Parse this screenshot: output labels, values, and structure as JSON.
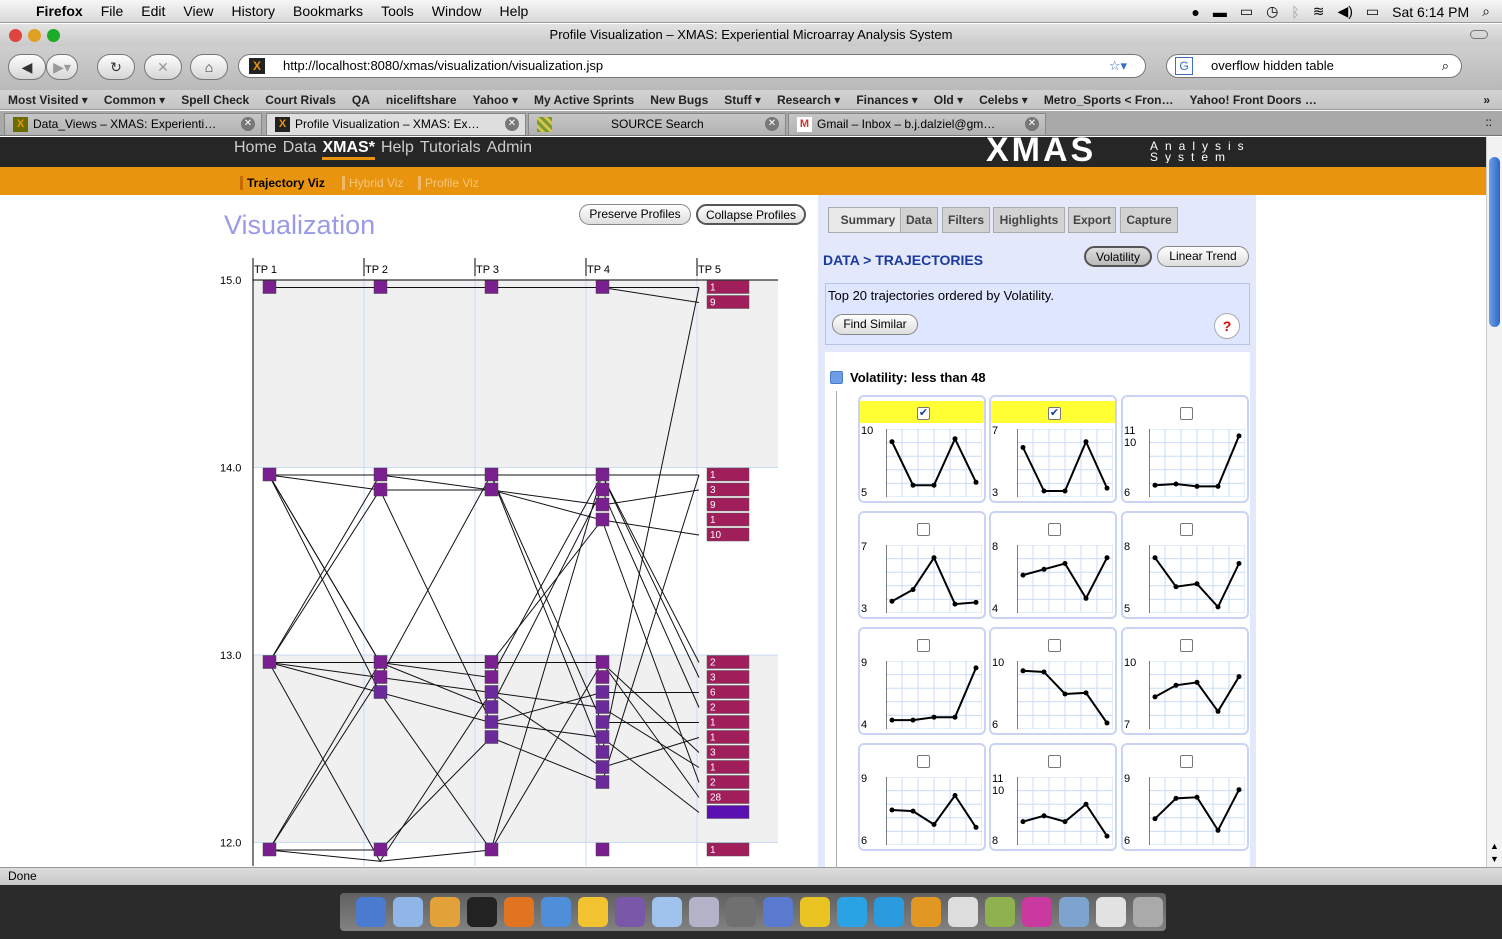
{
  "menubar": {
    "app": "Firefox",
    "items": [
      "File",
      "Edit",
      "View",
      "History",
      "Bookmarks",
      "Tools",
      "Window",
      "Help"
    ],
    "clock": "Sat 6:14 PM"
  },
  "window": {
    "title": "Profile Visualization – XMAS: Experiential Microarray Analysis System"
  },
  "nav": {
    "url": "http://localhost:8080/xmas/visualization/visualization.jsp",
    "search": "overflow hidden table"
  },
  "bookmarks": [
    "Most Visited ▾",
    "Common ▾",
    "Spell Check",
    "Court Rivals",
    "QA",
    "niceliftshare",
    "Yahoo ▾",
    "My Active Sprints",
    "New Bugs",
    "Stuff ▾",
    "Research ▾",
    "Finances ▾",
    "Old ▾",
    "Celebs ▾",
    "Metro_Sports < Fron…",
    "Yahoo! Front Doors …"
  ],
  "tabs": [
    {
      "label": "Data_Views – XMAS: Experienti…"
    },
    {
      "label": "Profile Visualization – XMAS: Ex…"
    },
    {
      "label": "SOURCE Search"
    },
    {
      "label": "Gmail – Inbox – b.j.dalziel@gm…"
    }
  ],
  "app": {
    "nav": [
      "Home",
      "Data",
      "XMAS*",
      "Help",
      "Tutorials",
      "Admin"
    ],
    "logo": "XMAS",
    "logo_sub": "Analysis System",
    "subnav": [
      "Trajectory Viz",
      "Hybrid Viz",
      "Profile Viz"
    ]
  },
  "main": {
    "title": "Visualization",
    "preserve": "Preserve Profiles",
    "collapse": "Collapse Profiles"
  },
  "chart_data": {
    "type": "line",
    "x": [
      "TP 1",
      "TP 2",
      "TP 3",
      "TP 4",
      "TP 5"
    ],
    "yticks": [
      "15.0",
      "14.0",
      "13.0",
      "12.0"
    ],
    "ylim": [
      11.9,
      15.1
    ],
    "labels": [
      {
        "y": 14.96,
        "text": "1"
      },
      {
        "y": 14.88,
        "text": "9"
      },
      {
        "y": 13.96,
        "text": "1"
      },
      {
        "y": 13.88,
        "text": "3"
      },
      {
        "y": 13.8,
        "text": "9"
      },
      {
        "y": 13.72,
        "text": "1"
      },
      {
        "y": 13.64,
        "text": "10"
      },
      {
        "y": 12.96,
        "text": "2"
      },
      {
        "y": 12.88,
        "text": "3"
      },
      {
        "y": 12.8,
        "text": "6"
      },
      {
        "y": 12.72,
        "text": "2"
      },
      {
        "y": 12.64,
        "text": "1"
      },
      {
        "y": 12.56,
        "text": "1"
      },
      {
        "y": 12.48,
        "text": "3"
      },
      {
        "y": 12.4,
        "text": "1"
      },
      {
        "y": 12.32,
        "text": "2"
      },
      {
        "y": 12.24,
        "text": "28"
      },
      {
        "y": 12.16,
        "text": ""
      },
      {
        "y": 11.96,
        "text": "1"
      }
    ],
    "nodes": [
      [
        0,
        14.96
      ],
      [
        1,
        14.96
      ],
      [
        2,
        14.96
      ],
      [
        3,
        14.96
      ],
      [
        0,
        13.96
      ],
      [
        1,
        13.96
      ],
      [
        1,
        13.88
      ],
      [
        2,
        13.96
      ],
      [
        2,
        13.88
      ],
      [
        3,
        13.96
      ],
      [
        3,
        13.88
      ],
      [
        3,
        13.8
      ],
      [
        3,
        13.72
      ],
      [
        0,
        12.96
      ],
      [
        1,
        12.96
      ],
      [
        1,
        12.88
      ],
      [
        1,
        12.8
      ],
      [
        2,
        12.96
      ],
      [
        2,
        12.88
      ],
      [
        2,
        12.8
      ],
      [
        2,
        12.72
      ],
      [
        2,
        12.64
      ],
      [
        2,
        12.56
      ],
      [
        3,
        12.96
      ],
      [
        3,
        12.88
      ],
      [
        3,
        12.8
      ],
      [
        3,
        12.72
      ],
      [
        3,
        12.64
      ],
      [
        3,
        12.56
      ],
      [
        3,
        12.48
      ],
      [
        3,
        12.4
      ],
      [
        3,
        12.32
      ],
      [
        0,
        11.96
      ],
      [
        1,
        11.96
      ],
      [
        2,
        11.96
      ],
      [
        3,
        11.96
      ]
    ],
    "lines": [
      [
        14.96,
        14.96,
        14.96,
        14.96,
        14.96
      ],
      [
        14.96,
        14.96,
        14.96,
        14.96,
        14.88
      ],
      [
        13.96,
        13.96,
        13.96,
        13.96,
        13.96
      ],
      [
        13.96,
        13.88,
        13.88,
        13.72,
        13.64
      ],
      [
        13.96,
        13.96,
        13.88,
        13.8,
        13.88
      ],
      [
        12.96,
        12.96,
        12.96,
        12.96,
        12.24
      ],
      [
        12.96,
        12.88,
        12.8,
        12.72,
        12.4
      ],
      [
        12.96,
        12.8,
        12.64,
        12.56,
        12.16
      ],
      [
        13.96,
        12.96,
        12.88,
        13.96,
        12.96
      ],
      [
        12.96,
        13.96,
        13.96,
        12.48,
        14.96
      ],
      [
        11.96,
        12.96,
        12.72,
        13.88,
        12.72
      ],
      [
        11.96,
        11.96,
        12.56,
        12.32,
        13.96
      ],
      [
        12.96,
        13.88,
        12.64,
        12.8,
        12.8
      ],
      [
        11.96,
        12.88,
        13.96,
        12.64,
        12.64
      ],
      [
        13.96,
        12.96,
        12.96,
        13.72,
        12.32
      ],
      [
        11.96,
        11.9,
        11.96,
        13.96,
        12.88
      ],
      [
        12.96,
        11.9,
        12.8,
        12.4,
        12.56
      ],
      [
        13.96,
        12.8,
        11.96,
        12.96,
        12.48
      ]
    ]
  },
  "panel": {
    "tabs": [
      "Summary",
      "Data",
      "Filters",
      "Highlights",
      "Export",
      "Capture"
    ],
    "heading": "DATA > TRAJECTORIES",
    "btn_vol": "Volatility",
    "btn_lin": "Linear Trend",
    "top_text": "Top 20 trajectories ordered by Volatility.",
    "find": "Find Similar",
    "help": "?",
    "group": "Volatility: less than 48",
    "thumbs": [
      {
        "top": "10",
        "bot": "5",
        "checked": true,
        "vals": [
          0.85,
          0.1,
          0.1,
          0.9,
          0.15
        ]
      },
      {
        "top": "7",
        "bot": "3",
        "checked": true,
        "vals": [
          0.75,
          0.0,
          0.0,
          0.85,
          0.05
        ]
      },
      {
        "top": "11",
        "mid": "10",
        "bot": "6",
        "checked": false,
        "vals": [
          0.1,
          0.12,
          0.08,
          0.08,
          0.95
        ]
      },
      {
        "top": "7",
        "bot": "3",
        "checked": false,
        "vals": [
          0.1,
          0.3,
          0.85,
          0.05,
          0.08
        ]
      },
      {
        "top": "8",
        "bot": "4",
        "checked": false,
        "vals": [
          0.55,
          0.65,
          0.75,
          0.15,
          0.85
        ]
      },
      {
        "top": "8",
        "bot": "5",
        "checked": false,
        "vals": [
          0.85,
          0.35,
          0.4,
          0.0,
          0.75
        ]
      },
      {
        "top": "9",
        "bot": "4",
        "checked": false,
        "vals": [
          0.05,
          0.05,
          0.1,
          0.1,
          0.95
        ]
      },
      {
        "top": "10",
        "bot": "6",
        "checked": false,
        "vals": [
          0.9,
          0.88,
          0.5,
          0.52,
          0.0
        ]
      },
      {
        "top": "10",
        "bot": "7",
        "checked": false,
        "vals": [
          0.45,
          0.65,
          0.7,
          0.2,
          0.8
        ]
      },
      {
        "top": "9",
        "bot": "6",
        "checked": false,
        "vals": [
          0.5,
          0.48,
          0.25,
          0.75,
          0.2
        ]
      },
      {
        "top": "11",
        "mid": "10",
        "bot": "8",
        "checked": false,
        "vals": [
          0.3,
          0.4,
          0.3,
          0.6,
          0.05
        ]
      },
      {
        "top": "9",
        "bot": "6",
        "checked": false,
        "vals": [
          0.35,
          0.7,
          0.72,
          0.15,
          0.85
        ]
      }
    ]
  },
  "status": "Done",
  "colors": {
    "accent": "#e8940e",
    "header": "#262626",
    "title": "#9a9ae6",
    "link": "#1a3a9c",
    "node": "#7a1f8f",
    "label": "#a01e5a"
  }
}
